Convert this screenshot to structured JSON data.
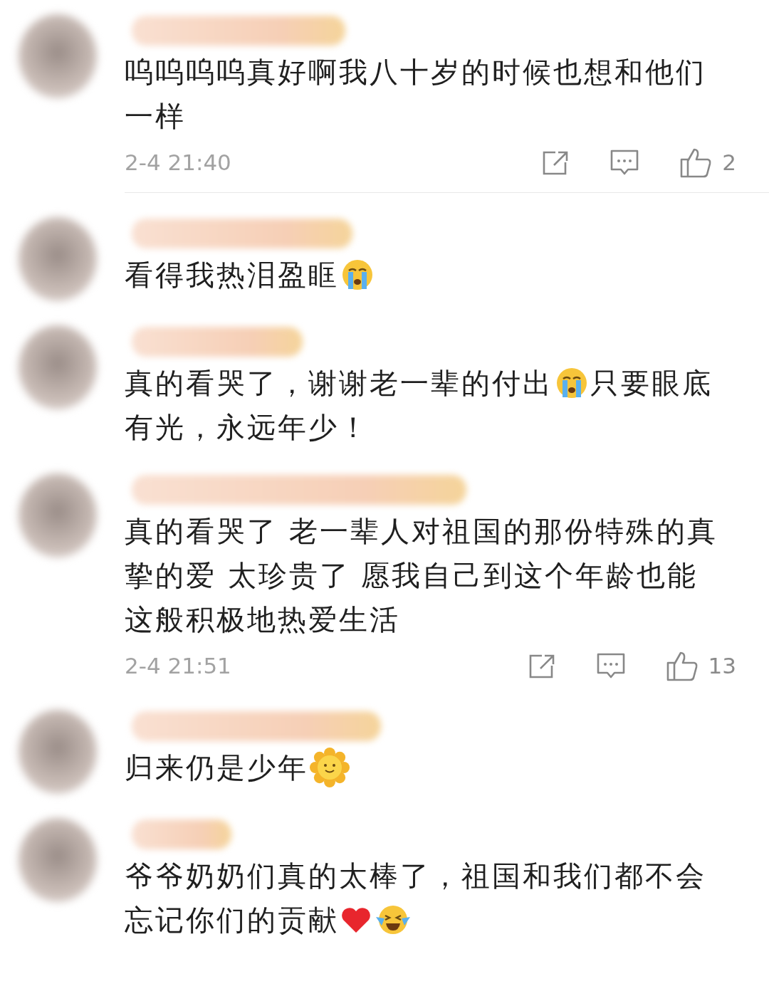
{
  "comments": [
    {
      "lines": [
        [
          {
            "kind": "text",
            "text": "呜呜呜呜真好啊我八十岁的时候也想和他们"
          }
        ],
        [
          {
            "kind": "text",
            "text": "一样"
          }
        ]
      ],
      "meta": {
        "time": "2-4 21:40",
        "likes": "2"
      },
      "divider_below": true
    },
    {
      "lines": [
        [
          {
            "kind": "text",
            "text": "看得我热泪盈眶"
          },
          {
            "kind": "cry"
          }
        ]
      ],
      "divider_below": false
    },
    {
      "lines": [
        [
          {
            "kind": "text",
            "text": "真的看哭了，谢谢老一辈的付出"
          },
          {
            "kind": "cry"
          },
          {
            "kind": "text",
            "text": "只要眼底"
          }
        ],
        [
          {
            "kind": "text",
            "text": "有光，永远年少！"
          }
        ]
      ],
      "divider_below": false
    },
    {
      "lines": [
        [
          {
            "kind": "text",
            "text": "真的看哭了 老一辈人对祖国的那份特殊的真"
          }
        ],
        [
          {
            "kind": "text",
            "text": "挚的爱 太珍贵了 愿我自己到这个年龄也能"
          }
        ],
        [
          {
            "kind": "text",
            "text": "这般积极地热爱生活"
          }
        ]
      ],
      "meta": {
        "time": "2-4 21:51",
        "likes": "13"
      },
      "divider_below": false
    },
    {
      "lines": [
        [
          {
            "kind": "text",
            "text": "归来仍是少年"
          },
          {
            "kind": "sun"
          }
        ]
      ],
      "divider_below": false
    },
    {
      "lines": [
        [
          {
            "kind": "text",
            "text": "爷爷奶奶们真的太棒了，祖国和我们都不会"
          }
        ],
        [
          {
            "kind": "text",
            "text": "忘记你们的贡献"
          },
          {
            "kind": "heart"
          },
          {
            "kind": "laugh"
          }
        ]
      ],
      "divider_below": false
    }
  ]
}
